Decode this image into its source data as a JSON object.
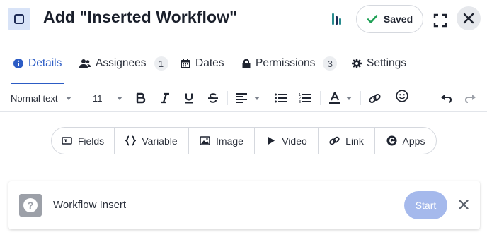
{
  "header": {
    "title": "Add \"Inserted Workflow\"",
    "saved_label": "Saved"
  },
  "tabs": [
    {
      "label": "Details",
      "icon": "info-icon",
      "active": true
    },
    {
      "label": "Assignees",
      "icon": "users-icon",
      "count": "1"
    },
    {
      "label": "Dates",
      "icon": "calendar-icon"
    },
    {
      "label": "Permissions",
      "icon": "lock-icon",
      "count": "3"
    },
    {
      "label": "Settings",
      "icon": "gear-icon"
    }
  ],
  "toolbar": {
    "text_style": "Normal text",
    "font_size": "11"
  },
  "insert_bar": [
    {
      "label": "Fields",
      "icon": "fields-icon"
    },
    {
      "label": "Variable",
      "icon": "braces-icon"
    },
    {
      "label": "Image",
      "icon": "image-icon"
    },
    {
      "label": "Video",
      "icon": "play-icon"
    },
    {
      "label": "Link",
      "icon": "link-icon"
    },
    {
      "label": "Apps",
      "icon": "apps-icon"
    }
  ],
  "workflow_insert": {
    "label": "Workflow Insert",
    "start_label": "Start"
  },
  "colors": {
    "accent": "#2c5cc5",
    "saved_check": "#1fa055",
    "start_button": "#a5b9ec"
  }
}
